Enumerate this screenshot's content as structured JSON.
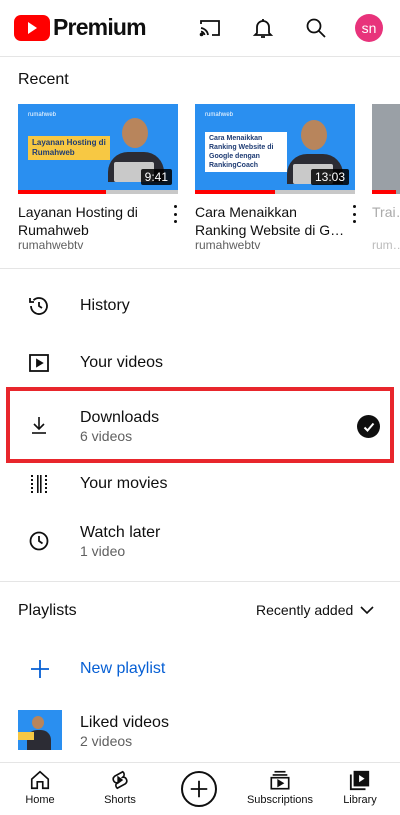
{
  "app": {
    "brand": "Premium",
    "avatar_initials": "sn",
    "avatar_color": "#e8337b",
    "accent": "#ff0000"
  },
  "topbar": {
    "icons": [
      "cast-icon",
      "bell-icon",
      "search-icon"
    ]
  },
  "recent": {
    "title": "Recent",
    "videos": [
      {
        "title": "Layanan Hosting di Rumahweb",
        "channel": "rumahwebtv",
        "duration": "9:41",
        "thumb_brand": "rumahweb",
        "thumb_caption": "Layanan Hosting di Rumahweb",
        "watched_fraction": 0.55
      },
      {
        "title": "Cara Menaikkan Ranking Website di G…",
        "channel": "rumahwebtv",
        "duration": "13:03",
        "thumb_brand": "rumahweb",
        "thumb_caption": "Cara Menaikkan Ranking Website di Google dengan RankingCoach",
        "watched_fraction": 0.5
      },
      {
        "title": "Trai…",
        "channel": "rum…",
        "duration": "",
        "watched_fraction": 0.85
      }
    ]
  },
  "menu": {
    "history": {
      "label": "History",
      "icon": "history-icon"
    },
    "your_videos": {
      "label": "Your videos",
      "icon": "play-square-icon"
    },
    "downloads": {
      "label": "Downloads",
      "sub": "6 videos",
      "icon": "download-icon",
      "status": "downloaded-check-icon"
    },
    "your_movies": {
      "label": "Your movies",
      "icon": "film-icon"
    },
    "watch_later": {
      "label": "Watch later",
      "sub": "1 video",
      "icon": "clock-icon"
    }
  },
  "playlists": {
    "title": "Playlists",
    "sort_label": "Recently added",
    "new_playlist": "New playlist",
    "liked": {
      "label": "Liked videos",
      "sub": "2 videos"
    }
  },
  "bottomnav": {
    "home": "Home",
    "shorts": "Shorts",
    "subscriptions": "Subscriptions",
    "library": "Library"
  }
}
